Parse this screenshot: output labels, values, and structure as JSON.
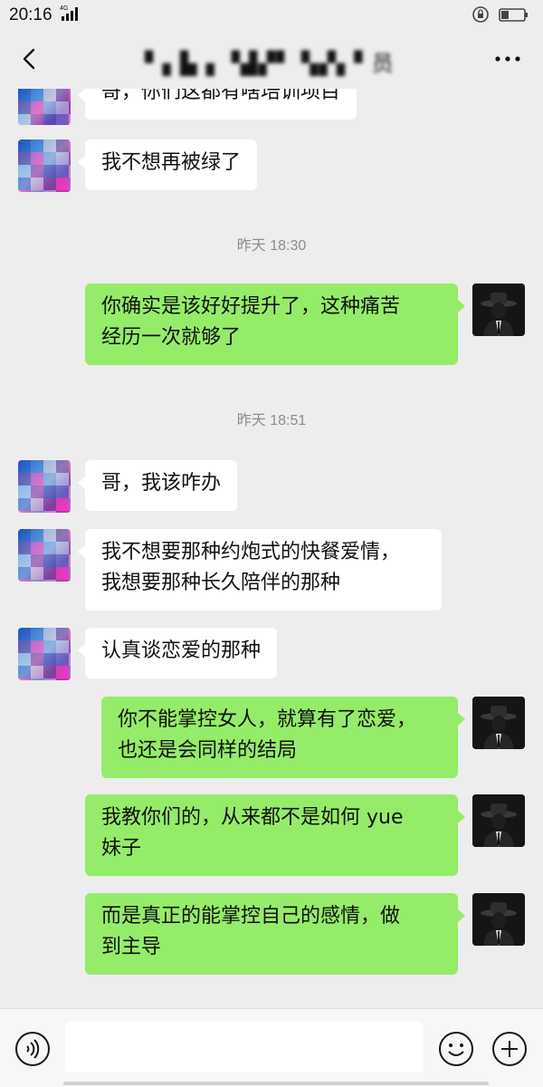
{
  "status_bar": {
    "time": "20:16",
    "network": "4G"
  },
  "nav": {
    "title": "▘▖▙▗ ▝▟▞▘ ▚▞▖▘员"
  },
  "messages": [
    {
      "side": "in",
      "text": "哥，你们这都有啥培训项目"
    },
    {
      "side": "in",
      "text": "我不想再被绿了"
    },
    {
      "type": "time",
      "text": "昨天 18:30"
    },
    {
      "side": "out",
      "lines": [
        "你确实是该好好提升了，这种痛苦",
        "经历一次就够了"
      ]
    },
    {
      "type": "time",
      "text": "昨天 18:51"
    },
    {
      "side": "in",
      "text": "哥，我该咋办"
    },
    {
      "side": "in",
      "lines": [
        "我不想要那种约炮式的快餐爱情，",
        "我想要那种长久陪伴的那种"
      ]
    },
    {
      "side": "in",
      "text": "认真谈恋爱的那种"
    },
    {
      "side": "out",
      "lines": [
        "你不能掌控女人，就算有了恋爱，",
        "也还是会同样的结局"
      ]
    },
    {
      "side": "out",
      "lines": [
        "我教你们的，从来都不是如何 yue",
        "妹子"
      ]
    },
    {
      "side": "out",
      "lines": [
        "而是真正的能掌控自己的感情，做",
        "到主导"
      ]
    }
  ],
  "icons": {
    "back": "chevron-left-icon",
    "more": "more-dots-icon",
    "voice": "voice-icon",
    "emoji": "emoji-icon",
    "plus": "plus-icon"
  },
  "colors": {
    "outgoing_bubble": "#95ec69",
    "incoming_bubble": "#ffffff",
    "background": "#ededed"
  }
}
